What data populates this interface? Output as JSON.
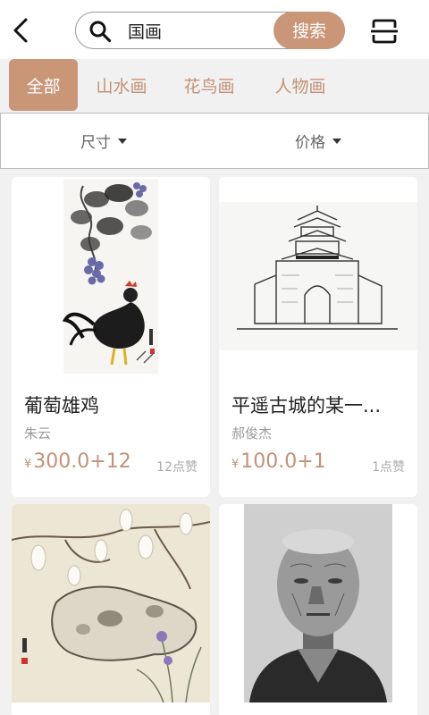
{
  "header": {
    "search_value": "国画",
    "search_button": "搜索"
  },
  "tabs": [
    {
      "label": "全部",
      "active": true
    },
    {
      "label": "山水画",
      "active": false
    },
    {
      "label": "花鸟画",
      "active": false
    },
    {
      "label": "人物画",
      "active": false
    }
  ],
  "filters": [
    {
      "label": "尺寸"
    },
    {
      "label": "价格"
    }
  ],
  "products": [
    {
      "title": "葡萄雄鸡",
      "artist": "朱云",
      "currency": "¥",
      "price": "300.0+12",
      "likes": "12点赞"
    },
    {
      "title": "平遥古城的某一...",
      "artist": "郝俊杰",
      "currency": "¥",
      "price": "100.0+1",
      "likes": "1点赞"
    },
    {
      "title": "",
      "artist": "",
      "currency": "",
      "price": "",
      "likes": ""
    },
    {
      "title": "",
      "artist": "",
      "currency": "",
      "price": "",
      "likes": ""
    }
  ],
  "colors": {
    "accent": "#c99678",
    "accent_text": "#c29277"
  },
  "icons": [
    "back-arrow-icon",
    "search-icon",
    "scan-icon",
    "chevron-down-icon"
  ]
}
